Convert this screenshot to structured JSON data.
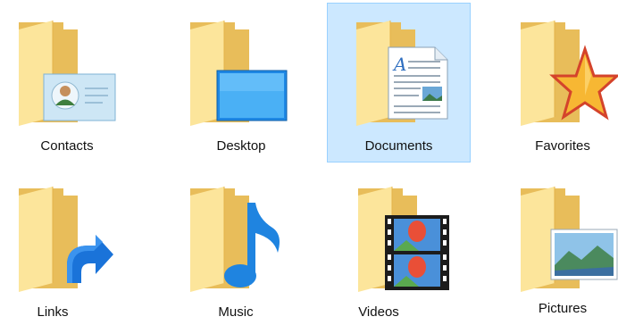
{
  "colors": {
    "folder_back": "#e8bd5a",
    "folder_front": "#fce59b",
    "selection_fill": "#cce8ff",
    "selection_border": "#99d1ff"
  },
  "folders": [
    {
      "label": "Contacts",
      "icon": "contact-card-icon",
      "selected": false
    },
    {
      "label": "Desktop",
      "icon": "desktop-screen-icon",
      "selected": false
    },
    {
      "label": "Documents",
      "icon": "document-page-icon",
      "selected": true
    },
    {
      "label": "Favorites",
      "icon": "star-icon",
      "selected": false
    },
    {
      "label": "Links",
      "icon": "link-arrow-icon",
      "selected": false
    },
    {
      "label": "Music",
      "icon": "music-note-icon",
      "selected": false
    },
    {
      "label": "Videos",
      "icon": "film-strip-icon",
      "selected": false
    },
    {
      "label": "Pictures",
      "icon": "landscape-photo-icon",
      "selected": false
    }
  ]
}
